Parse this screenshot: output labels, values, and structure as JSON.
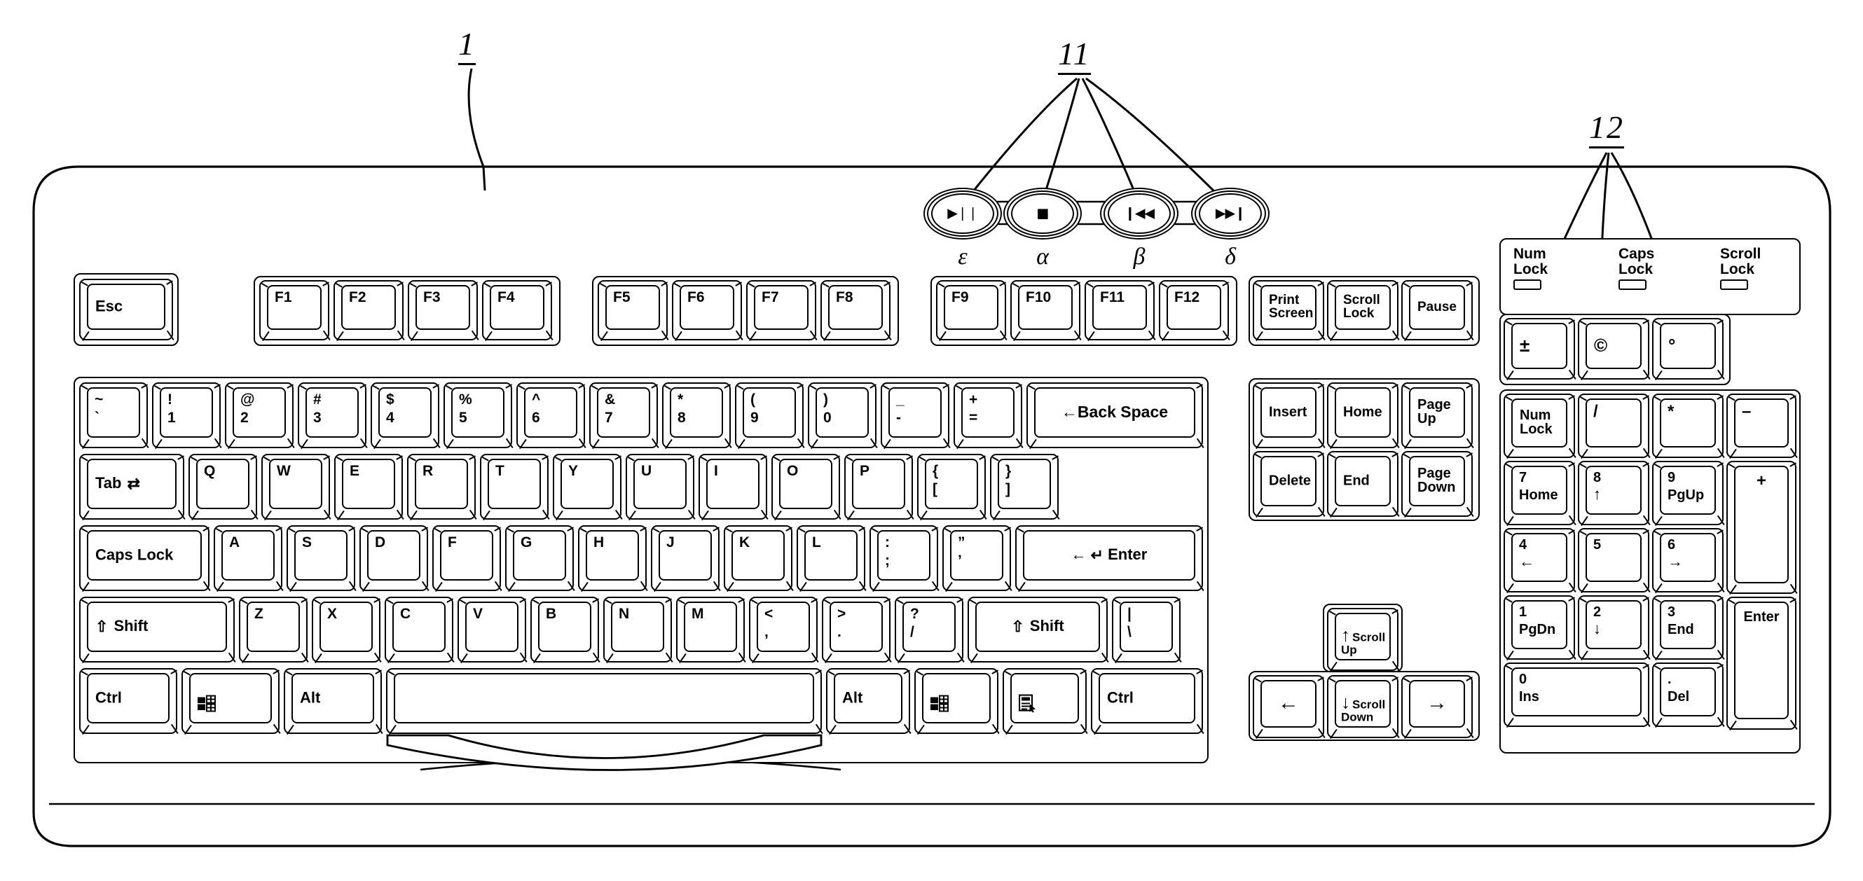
{
  "figure": {
    "title": "Keyboard with multimedia buttons and special symbol keys",
    "reference_numerals": [
      {
        "id": "1",
        "label": "1",
        "describes": "keyboard-body"
      },
      {
        "id": "11",
        "label": "11",
        "describes": "multimedia-buttons"
      },
      {
        "id": "12",
        "label": "12",
        "describes": "special-symbol-keys"
      }
    ]
  },
  "media_buttons": {
    "group_ref": "11",
    "buttons": [
      {
        "glyph": "play-pause-icon",
        "glyph_text": "▶❘❘",
        "greek": "ε"
      },
      {
        "glyph": "stop-icon",
        "glyph_text": "■",
        "greek": "α"
      },
      {
        "glyph": "previous-track-icon",
        "glyph_text": "❙◀◀",
        "greek": "β"
      },
      {
        "glyph": "next-track-icon",
        "glyph_text": "▶▶❙",
        "greek": "δ"
      }
    ]
  },
  "led_panel": {
    "group_ref": "12",
    "indicators": [
      {
        "label": "Num\nLock"
      },
      {
        "label": "Caps\nLock"
      },
      {
        "label": "Scroll\nLock"
      }
    ]
  },
  "special_keys": {
    "group_ref": "12",
    "keys": [
      {
        "label": "±",
        "name": "plus-minus-key"
      },
      {
        "label": "©",
        "name": "copyright-key"
      },
      {
        "label": "°",
        "name": "degree-key"
      }
    ]
  },
  "esc_key": {
    "label": "Esc"
  },
  "function_keys": {
    "group_a": [
      "F1",
      "F2",
      "F3",
      "F4"
    ],
    "group_b": [
      "F5",
      "F6",
      "F7",
      "F8"
    ],
    "group_c": [
      "F9",
      "F10",
      "F11",
      "F12"
    ]
  },
  "system_keys": [
    {
      "label": "Print\nScreen"
    },
    {
      "label": "Scroll\nLock"
    },
    {
      "label": "Pause"
    }
  ],
  "nav_keys_upper": [
    {
      "label": "Insert"
    },
    {
      "label": "Home"
    },
    {
      "label": "Page\nUp"
    }
  ],
  "nav_keys_lower": [
    {
      "label": "Delete"
    },
    {
      "label": "End"
    },
    {
      "label": "Page\nDown"
    }
  ],
  "arrow_cluster": {
    "up": {
      "label": "Scroll\nUp",
      "arrow": "↑"
    },
    "left": {
      "label": "",
      "arrow": "←"
    },
    "down": {
      "label": "Scroll\nDown",
      "arrow": "↓"
    },
    "right": {
      "label": "",
      "arrow": "→"
    }
  },
  "main_rows": {
    "number_row": [
      {
        "top": "~",
        "bottom": "`"
      },
      {
        "top": "!",
        "bottom": "1"
      },
      {
        "top": "@",
        "bottom": "2"
      },
      {
        "top": "#",
        "bottom": "3"
      },
      {
        "top": "$",
        "bottom": "4"
      },
      {
        "top": "%",
        "bottom": "5"
      },
      {
        "top": "^",
        "bottom": "6"
      },
      {
        "top": "&",
        "bottom": "7"
      },
      {
        "top": "*",
        "bottom": "8"
      },
      {
        "top": "(",
        "bottom": "9"
      },
      {
        "top": ")",
        "bottom": "0"
      },
      {
        "top": "_",
        "bottom": "-"
      },
      {
        "top": "+",
        "bottom": "="
      }
    ],
    "backspace": {
      "label": "Back Space",
      "arrow": "←"
    },
    "tab": {
      "label": "Tab"
    },
    "qwerty_row": [
      "Q",
      "W",
      "E",
      "R",
      "T",
      "Y",
      "U",
      "I",
      "O",
      "P"
    ],
    "qwerty_tail": [
      {
        "top": "{",
        "bottom": "["
      },
      {
        "top": "}",
        "bottom": "]"
      }
    ],
    "caps_lock": {
      "label": "Caps Lock"
    },
    "asdf_row": [
      "A",
      "S",
      "D",
      "F",
      "G",
      "H",
      "J",
      "K",
      "L"
    ],
    "asdf_tail": [
      {
        "top": ":",
        "bottom": ";"
      },
      {
        "top": "”",
        "bottom": "’"
      }
    ],
    "enter": {
      "label": "Enter",
      "arrow": "←",
      "return": "↵"
    },
    "shift_left": {
      "label": "Shift",
      "arrow": "⇧"
    },
    "zxcv_row": [
      "Z",
      "X",
      "C",
      "V",
      "B",
      "N",
      "M"
    ],
    "zxcv_tail": [
      {
        "top": "<",
        "bottom": ","
      },
      {
        "top": ">",
        "bottom": "."
      },
      {
        "top": "?",
        "bottom": "/"
      }
    ],
    "shift_right": {
      "label": "Shift",
      "arrow": "⇧"
    },
    "pipe_key": {
      "top": "|",
      "bottom": "\\"
    },
    "bottom_row": [
      {
        "label": "Ctrl",
        "name": "ctrl-left-key"
      },
      {
        "label": "",
        "name": "windows-left-key",
        "icon": "windows-icon"
      },
      {
        "label": "Alt",
        "name": "alt-left-key"
      },
      {
        "label": "",
        "name": "spacebar"
      },
      {
        "label": "Alt",
        "name": "alt-right-key"
      },
      {
        "label": "",
        "name": "windows-right-key",
        "icon": "windows-icon"
      },
      {
        "label": "",
        "name": "menu-key",
        "icon": "context-menu-icon"
      },
      {
        "label": "Ctrl",
        "name": "ctrl-right-key"
      }
    ]
  },
  "numpad": {
    "row1": [
      {
        "label": "Num\nLock"
      },
      {
        "label": "/"
      },
      {
        "label": "*"
      },
      {
        "label": "–"
      }
    ],
    "row2": [
      {
        "top": "7",
        "bottom": "Home"
      },
      {
        "top": "8",
        "bottom": "↑"
      },
      {
        "top": "9",
        "bottom": "PgUp"
      }
    ],
    "plus": {
      "label": "+"
    },
    "row3": [
      {
        "top": "4",
        "bottom": "←"
      },
      {
        "top": "5",
        "bottom": ""
      },
      {
        "top": "6",
        "bottom": "→"
      }
    ],
    "row4": [
      {
        "top": "1",
        "bottom": "PgDn"
      },
      {
        "top": "2",
        "bottom": "↓"
      },
      {
        "top": "3",
        "bottom": "End"
      }
    ],
    "enter": {
      "label": "Enter"
    },
    "row5": [
      {
        "top": "0",
        "bottom": "Ins"
      },
      {
        "top": ".",
        "bottom": "Del"
      }
    ]
  },
  "colors": {
    "line": "#000000",
    "fill": "#ffffff"
  }
}
